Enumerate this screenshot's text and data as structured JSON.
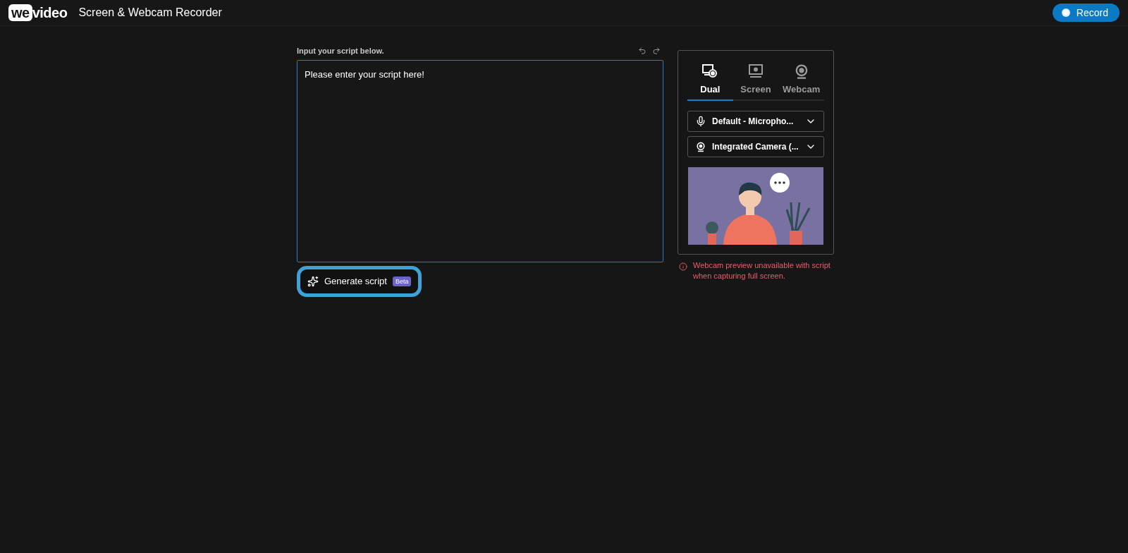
{
  "header": {
    "logo_mark": "we",
    "logo_text": "video",
    "title": "Screen & Webcam Recorder",
    "record_button": "Record"
  },
  "script": {
    "label": "Input your script below.",
    "placeholder": "Please enter your script here!",
    "generate_button": "Generate script",
    "beta_badge": "Beta"
  },
  "capture_tabs": [
    {
      "kind": "dual",
      "label": "Dual",
      "selected": true
    },
    {
      "kind": "screen",
      "label": "Screen",
      "selected": false
    },
    {
      "kind": "webcam",
      "label": "Webcam",
      "selected": false
    }
  ],
  "devices": [
    {
      "kind": "microphone",
      "value": "Default - Micropho..."
    },
    {
      "kind": "camera",
      "value": "Integrated Camera (..."
    }
  ],
  "warning": "Webcam preview unavailable with script when capturing full screen."
}
